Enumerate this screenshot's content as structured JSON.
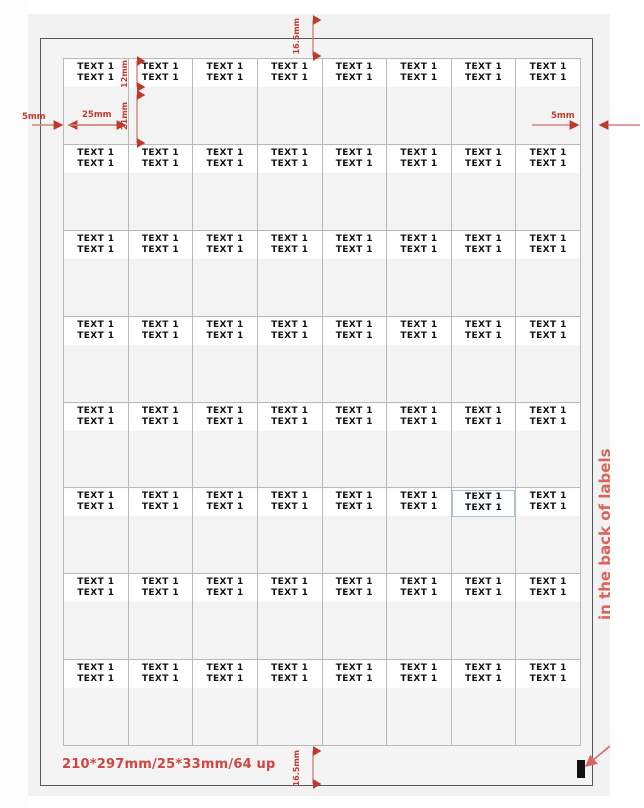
{
  "document": {
    "type": "label-sheet-template",
    "page_border_color": "#555a5c",
    "annotation_color": "#c0392b",
    "grid": {
      "columns": 8,
      "rows": 8,
      "total_labels": 64,
      "cell_line_1": "TEXT 1",
      "cell_line_2": "TEXT 1",
      "highlighted_cell": {
        "row": 6,
        "column": 7,
        "border_color": "#9ec8e0"
      }
    }
  },
  "annotations": {
    "top_margin": "16.5mm",
    "bottom_margin": "16.5mm",
    "left_margin": "5mm",
    "right_margin": "5mm",
    "label_width": "25mm",
    "text_area_height": "12mm",
    "label_body_height": "21mm"
  },
  "captions": {
    "spec": "210*297mm/25*33mm/64 up",
    "side_note": "in the back of labels"
  }
}
